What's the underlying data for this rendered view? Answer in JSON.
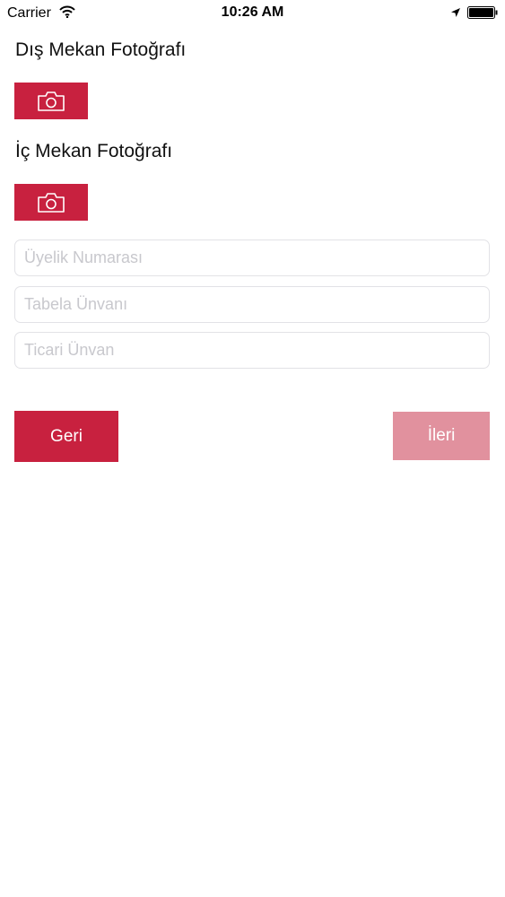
{
  "status_bar": {
    "carrier": "Carrier",
    "time": "10:26 AM"
  },
  "form": {
    "exterior_photo_title": "Dış Mekan Fotoğrafı",
    "interior_photo_title": "İç Mekan Fotoğrafı",
    "membership_number_placeholder": "Üyelik Numarası",
    "sign_title_placeholder": "Tabela Ünvanı",
    "trade_name_placeholder": "Ticari Ünvan"
  },
  "actions": {
    "back_label": "Geri",
    "next_label": "İleri",
    "next_enabled": false
  },
  "colors": {
    "primary": "#c8213f",
    "primary_disabled": "#e1919e",
    "field_border": "#e2e2e6",
    "placeholder": "#c8c8cd"
  }
}
